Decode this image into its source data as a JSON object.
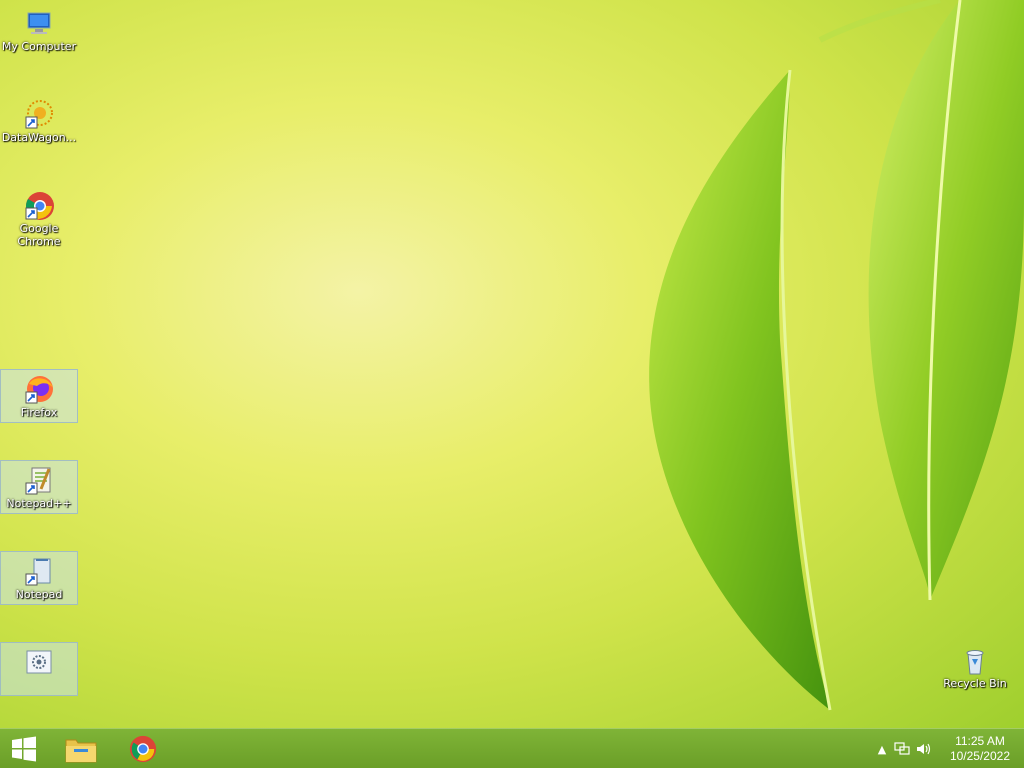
{
  "desktop": {
    "icons": [
      {
        "label": "My Computer",
        "icon": "computer-icon"
      },
      {
        "label": "DataWagon...",
        "icon": "datawagon-icon"
      },
      {
        "label": "Google\nChrome",
        "icon": "chrome-icon"
      },
      {
        "label": "Firefox",
        "icon": "firefox-icon"
      },
      {
        "label": "Notepad++",
        "icon": "notepad-plus-plus-icon"
      },
      {
        "label": "Notepad",
        "icon": "notepad-icon"
      },
      {
        "label": "",
        "icon": "shortcut-app-icon"
      },
      {
        "label": "Recycle Bin",
        "icon": "recycle-bin-icon"
      }
    ]
  },
  "taskbar": {
    "start_icon": "windows-start-icon",
    "pinned": [
      "file-explorer-icon",
      "chrome-icon"
    ],
    "tray": {
      "time": "11:25 AM",
      "date": "10/25/2022",
      "icons": [
        "show-hidden-icons-arrow",
        "network-icon",
        "volume-icon"
      ]
    }
  },
  "colors": {
    "taskbar": "#6fa42b",
    "wallpaper_accent": "#8fcf2a"
  }
}
